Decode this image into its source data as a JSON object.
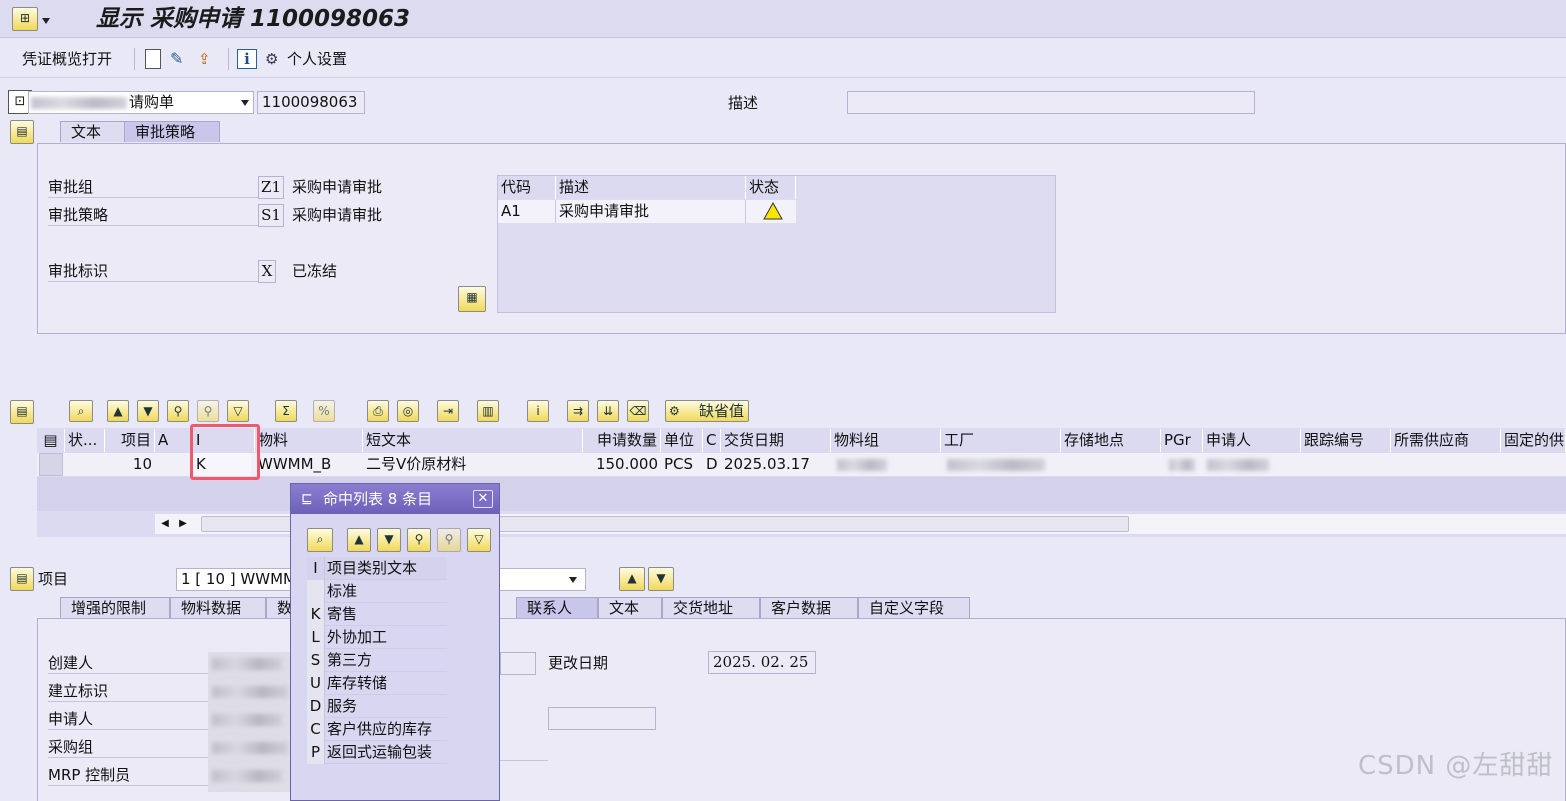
{
  "title": "显示 采购申请 1100098063",
  "toolbar": {
    "open_label": "凭证概览打开",
    "personal_settings": "个人设置"
  },
  "header": {
    "doc_type": "请购单",
    "doc_number": "1100098063",
    "description_label": "描述",
    "description_value": ""
  },
  "header_tabs": [
    "文本",
    "审批策略"
  ],
  "approval": {
    "group_label": "审批组",
    "group_code": "Z1",
    "group_text": "采购申请审批",
    "strategy_label": "审批策略",
    "strategy_code": "S1",
    "strategy_text": "采购申请审批",
    "release_label": "审批标识",
    "release_code": "X",
    "release_text": "已冻结",
    "table_headers": [
      "代码",
      "描述",
      "状态"
    ],
    "table_rows": [
      {
        "code": "A1",
        "desc": "采购申请审批",
        "status": "warning"
      }
    ]
  },
  "items_toolbar": {
    "default_button": "缺省值"
  },
  "items_table": {
    "headers": [
      "状...",
      "项目",
      "A",
      "I",
      "物料",
      "短文本",
      "申请数量",
      "单位",
      "C",
      "交货日期",
      "物料组",
      "工厂",
      "存储地点",
      "PGr",
      "申请人",
      "跟踪编号",
      "所需供应商",
      "固定的供"
    ],
    "row": {
      "status": "",
      "item": "10",
      "a": "",
      "i": "K",
      "material": "WWMM_B",
      "short_text": "二号V价原材料",
      "quantity": "150.000",
      "unit": "PCS",
      "c": "D",
      "delivery_date": "2025.03.17"
    }
  },
  "item_detail": {
    "label": "项目",
    "selector": "1 [ 10 ] WWMM",
    "tabs": [
      "增强的限制",
      "物料数据",
      "数",
      "联系人",
      "文本",
      "交货地址",
      "客户数据",
      "自定义字段"
    ],
    "fields": [
      "创建人",
      "建立标识",
      "申请人",
      "采购组",
      "MRP 控制员"
    ],
    "change_date_label": "更改日期",
    "change_date": "2025. 02. 25"
  },
  "popup": {
    "title": "命中列表 8 条目",
    "header_key": "I",
    "header_text": "项目类别文本",
    "entries": [
      {
        "key": "",
        "text": "标准"
      },
      {
        "key": "K",
        "text": "寄售"
      },
      {
        "key": "L",
        "text": "外协加工"
      },
      {
        "key": "S",
        "text": "第三方"
      },
      {
        "key": "U",
        "text": "库存转储"
      },
      {
        "key": "D",
        "text": "服务"
      },
      {
        "key": "C",
        "text": "客户供应的库存"
      },
      {
        "key": "P",
        "text": "返回式运输包装"
      }
    ]
  },
  "watermark": "CSDN @左甜甜",
  "colors": {
    "highlight_box": "#ee5a6c",
    "popup_title_bg": "#7a6cc4",
    "panel_bg": "#eceaf7"
  }
}
